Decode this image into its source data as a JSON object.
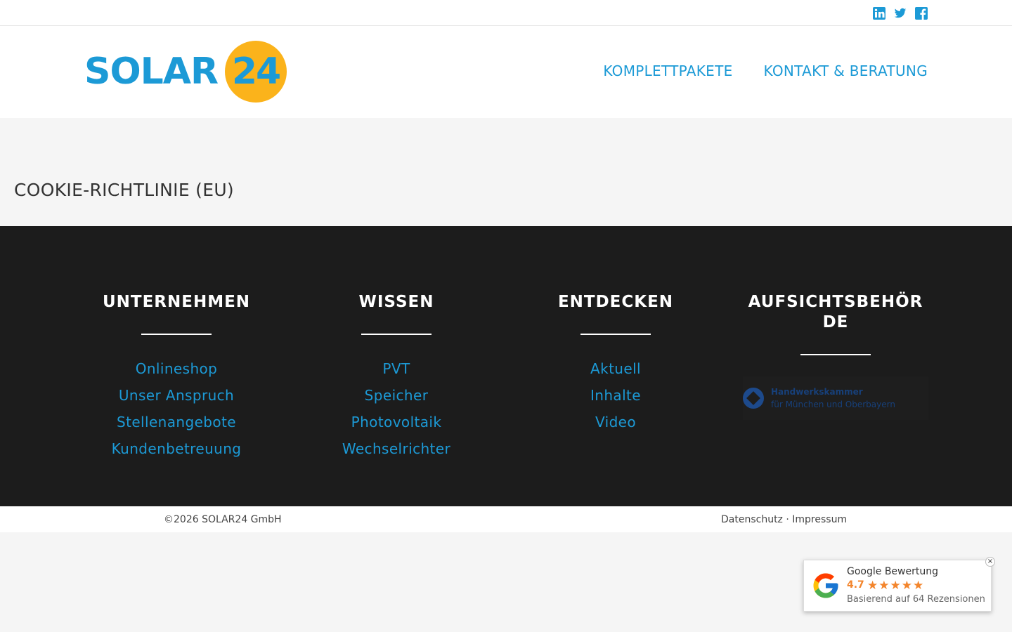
{
  "social": [
    {
      "name": "linkedin-icon"
    },
    {
      "name": "twitter-icon"
    },
    {
      "name": "facebook-icon"
    }
  ],
  "logo": {
    "text": "SOLAR",
    "number": "24"
  },
  "nav": {
    "item1": "KOMPLETTPAKETE",
    "item2": "KONTAKT & BERATUNG"
  },
  "page": {
    "title": "COOKIE-RICHTLINIE (EU)"
  },
  "footer": {
    "col1": {
      "heading": "UNTERNEHMEN",
      "links": [
        "Onlineshop",
        "Unser Anspruch",
        "Stellenangebote",
        "Kundenbetreuung"
      ]
    },
    "col2": {
      "heading": "WISSEN",
      "links": [
        "PVT",
        "Speicher",
        "Photovoltaik",
        "Wechselrichter"
      ]
    },
    "col3": {
      "heading": "ENTDECKEN",
      "links": [
        "Aktuell",
        "Inhalte",
        "Video"
      ]
    },
    "col4": {
      "heading": "AUFSICHTSBEHÖR DE",
      "hwk_line1": "Handwerkskammer",
      "hwk_line2": "für München und Oberbayern"
    }
  },
  "bottom": {
    "copyright": "©2026 SOLAR24 GmbH",
    "privacy": "Datenschutz",
    "separator": " · ",
    "imprint": "Impressum"
  },
  "google": {
    "title": "Google Bewertung",
    "rating": "4.7",
    "stars": "★★★★★",
    "subtitle": "Basierend auf 64 Rezensionen",
    "close": "×"
  },
  "colors": {
    "brand_blue": "#1c9ad6",
    "brand_yellow": "#fbb31b",
    "footer_bg": "#1c1c1c",
    "rating_orange": "#f3852c"
  }
}
